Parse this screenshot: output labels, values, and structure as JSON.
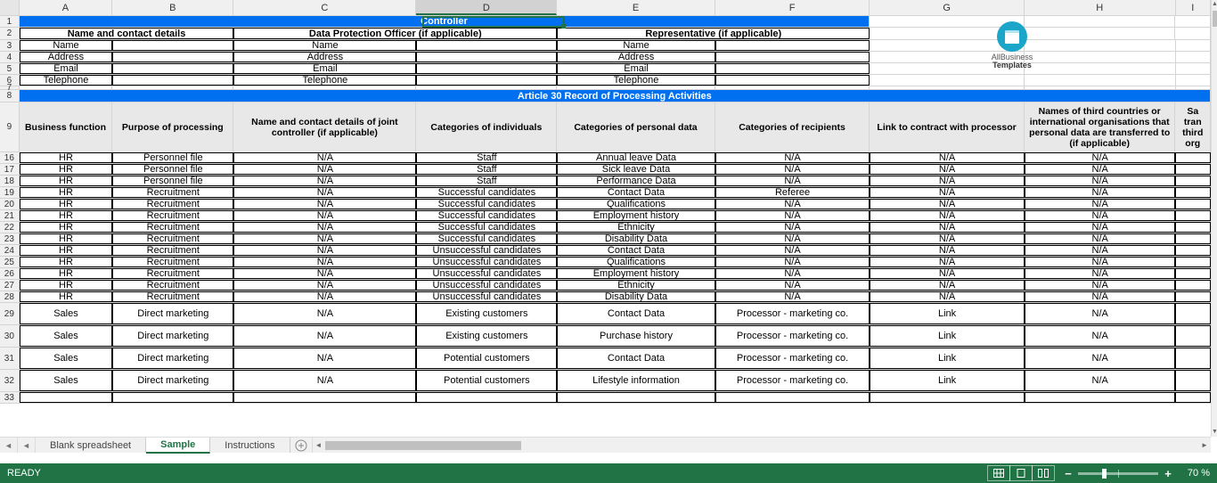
{
  "columns": [
    "A",
    "B",
    "C",
    "D",
    "E",
    "F",
    "G",
    "H",
    "I"
  ],
  "active_column": "D",
  "row_nums_top": [
    1,
    2,
    3,
    4,
    5,
    6,
    7,
    8,
    9
  ],
  "row_nums_data": [
    16,
    17,
    18,
    19,
    20,
    21,
    22,
    23,
    24,
    25,
    26,
    27,
    28,
    29,
    30,
    31,
    32,
    33
  ],
  "header": {
    "controller": "Controller",
    "sections": [
      "Name and contact details",
      "Data Protection Officer (if applicable)",
      "Representative (if applicable)"
    ],
    "fields": [
      "Name",
      "Address",
      "Email",
      "Telephone"
    ]
  },
  "logo": {
    "line1": "AllBusiness",
    "line2": "Templates"
  },
  "article_title": "Article 30 Record of Processing Activities",
  "table_headers": [
    "Business function",
    "Purpose of processing",
    "Name and contact details of joint controller (if applicable)",
    "Categories of individuals",
    "Categories of personal data",
    "Categories of recipients",
    "Link to contract with processor",
    "Names of third countries or international organisations that personal data are transferred to (if applicable)",
    "Sa\ntran\nthird\norg"
  ],
  "rows": [
    {
      "bf": "HR",
      "pp": "Personnel file",
      "jc": "N/A",
      "ci": "Staff",
      "cpd": "Annual leave Data",
      "cr": "N/A",
      "link": "N/A",
      "tc": "N/A"
    },
    {
      "bf": "HR",
      "pp": "Personnel file",
      "jc": "N/A",
      "ci": "Staff",
      "cpd": "Sick leave Data",
      "cr": "N/A",
      "link": "N/A",
      "tc": "N/A"
    },
    {
      "bf": "HR",
      "pp": "Personnel file",
      "jc": "N/A",
      "ci": "Staff",
      "cpd": "Performance Data",
      "cr": "N/A",
      "link": "N/A",
      "tc": "N/A"
    },
    {
      "bf": "HR",
      "pp": "Recruitment",
      "jc": "N/A",
      "ci": "Successful candidates",
      "cpd": "Contact Data",
      "cr": "Referee",
      "link": "N/A",
      "tc": "N/A"
    },
    {
      "bf": "HR",
      "pp": "Recruitment",
      "jc": "N/A",
      "ci": "Successful candidates",
      "cpd": "Qualifications",
      "cr": "N/A",
      "link": "N/A",
      "tc": "N/A"
    },
    {
      "bf": "HR",
      "pp": "Recruitment",
      "jc": "N/A",
      "ci": "Successful candidates",
      "cpd": "Employment history",
      "cr": "N/A",
      "link": "N/A",
      "tc": "N/A"
    },
    {
      "bf": "HR",
      "pp": "Recruitment",
      "jc": "N/A",
      "ci": "Successful candidates",
      "cpd": "Ethnicity",
      "cr": "N/A",
      "link": "N/A",
      "tc": "N/A"
    },
    {
      "bf": "HR",
      "pp": "Recruitment",
      "jc": "N/A",
      "ci": "Successful candidates",
      "cpd": "Disability Data",
      "cr": "N/A",
      "link": "N/A",
      "tc": "N/A"
    },
    {
      "bf": "HR",
      "pp": "Recruitment",
      "jc": "N/A",
      "ci": "Unsuccessful candidates",
      "cpd": "Contact Data",
      "cr": "N/A",
      "link": "N/A",
      "tc": "N/A"
    },
    {
      "bf": "HR",
      "pp": "Recruitment",
      "jc": "N/A",
      "ci": "Unsuccessful candidates",
      "cpd": "Qualifications",
      "cr": "N/A",
      "link": "N/A",
      "tc": "N/A"
    },
    {
      "bf": "HR",
      "pp": "Recruitment",
      "jc": "N/A",
      "ci": "Unsuccessful candidates",
      "cpd": "Employment history",
      "cr": "N/A",
      "link": "N/A",
      "tc": "N/A"
    },
    {
      "bf": "HR",
      "pp": "Recruitment",
      "jc": "N/A",
      "ci": "Unsuccessful candidates",
      "cpd": "Ethnicity",
      "cr": "N/A",
      "link": "N/A",
      "tc": "N/A"
    },
    {
      "bf": "HR",
      "pp": "Recruitment",
      "jc": "N/A",
      "ci": "Unsuccessful candidates",
      "cpd": "Disability Data",
      "cr": "N/A",
      "link": "N/A",
      "tc": "N/A"
    },
    {
      "bf": "Sales",
      "pp": "Direct marketing",
      "jc": "N/A",
      "ci": "Existing customers",
      "cpd": "Contact Data",
      "cr": "Processor - marketing co.",
      "link": "Link",
      "tc": "N/A",
      "tall": true
    },
    {
      "bf": "Sales",
      "pp": "Direct marketing",
      "jc": "N/A",
      "ci": "Existing customers",
      "cpd": "Purchase history",
      "cr": "Processor - marketing co.",
      "link": "Link",
      "tc": "N/A",
      "tall": true
    },
    {
      "bf": "Sales",
      "pp": "Direct marketing",
      "jc": "N/A",
      "ci": "Potential customers",
      "cpd": "Contact Data",
      "cr": "Processor - marketing co.",
      "link": "Link",
      "tc": "N/A",
      "tall": true
    },
    {
      "bf": "Sales",
      "pp": "Direct marketing",
      "jc": "N/A",
      "ci": "Potential customers",
      "cpd": "Lifestyle information",
      "cr": "Processor - marketing co.",
      "link": "Link",
      "tc": "N/A",
      "tall": true
    },
    {
      "bf": "",
      "pp": "",
      "jc": "",
      "ci": "",
      "cpd": "",
      "cr": "",
      "link": "",
      "tc": ""
    }
  ],
  "tabs": [
    {
      "label": "Blank spreadsheet",
      "active": false
    },
    {
      "label": "Sample",
      "active": true
    },
    {
      "label": "Instructions",
      "active": false
    }
  ],
  "status": {
    "ready": "READY",
    "zoom": "70 %"
  }
}
